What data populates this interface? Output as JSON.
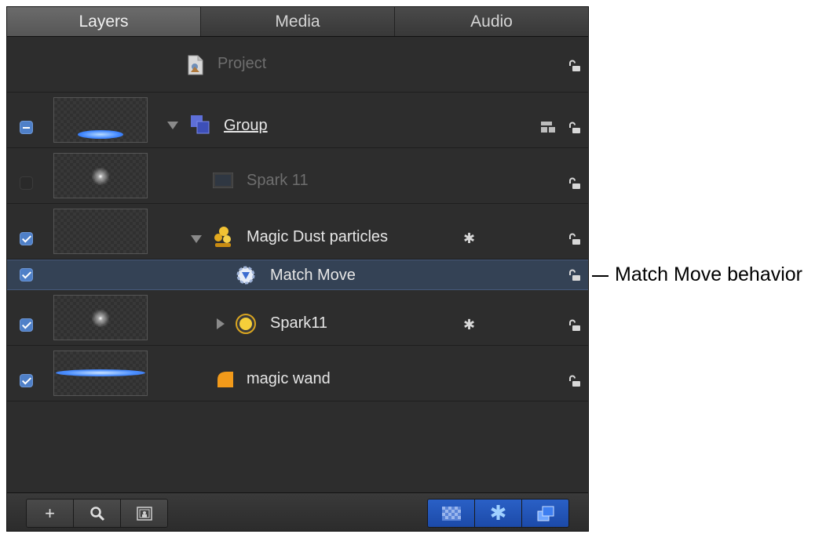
{
  "tabs": [
    {
      "label": "Layers"
    },
    {
      "label": "Media"
    },
    {
      "label": "Audio"
    }
  ],
  "rows": {
    "project": {
      "label": "Project"
    },
    "group": {
      "label": "Group"
    },
    "spark11_hidden": {
      "label": "Spark 11"
    },
    "magic_dust": {
      "label": "Magic Dust particles"
    },
    "match_move": {
      "label": "Match Move"
    },
    "spark11": {
      "label": "Spark11"
    },
    "magic_wand": {
      "label": "magic wand"
    }
  },
  "callout": {
    "text": "Match Move behavior"
  },
  "bottombar": {
    "add_label": "+",
    "search_icon": "search-icon",
    "thumbnail_toggle_icon": "thumbnail-icon"
  },
  "colors": {
    "panel_bg": "#2d2d2d",
    "selection": "#344255",
    "checkbox": "#4f80c8",
    "toggle_active": "#2a60c6"
  }
}
